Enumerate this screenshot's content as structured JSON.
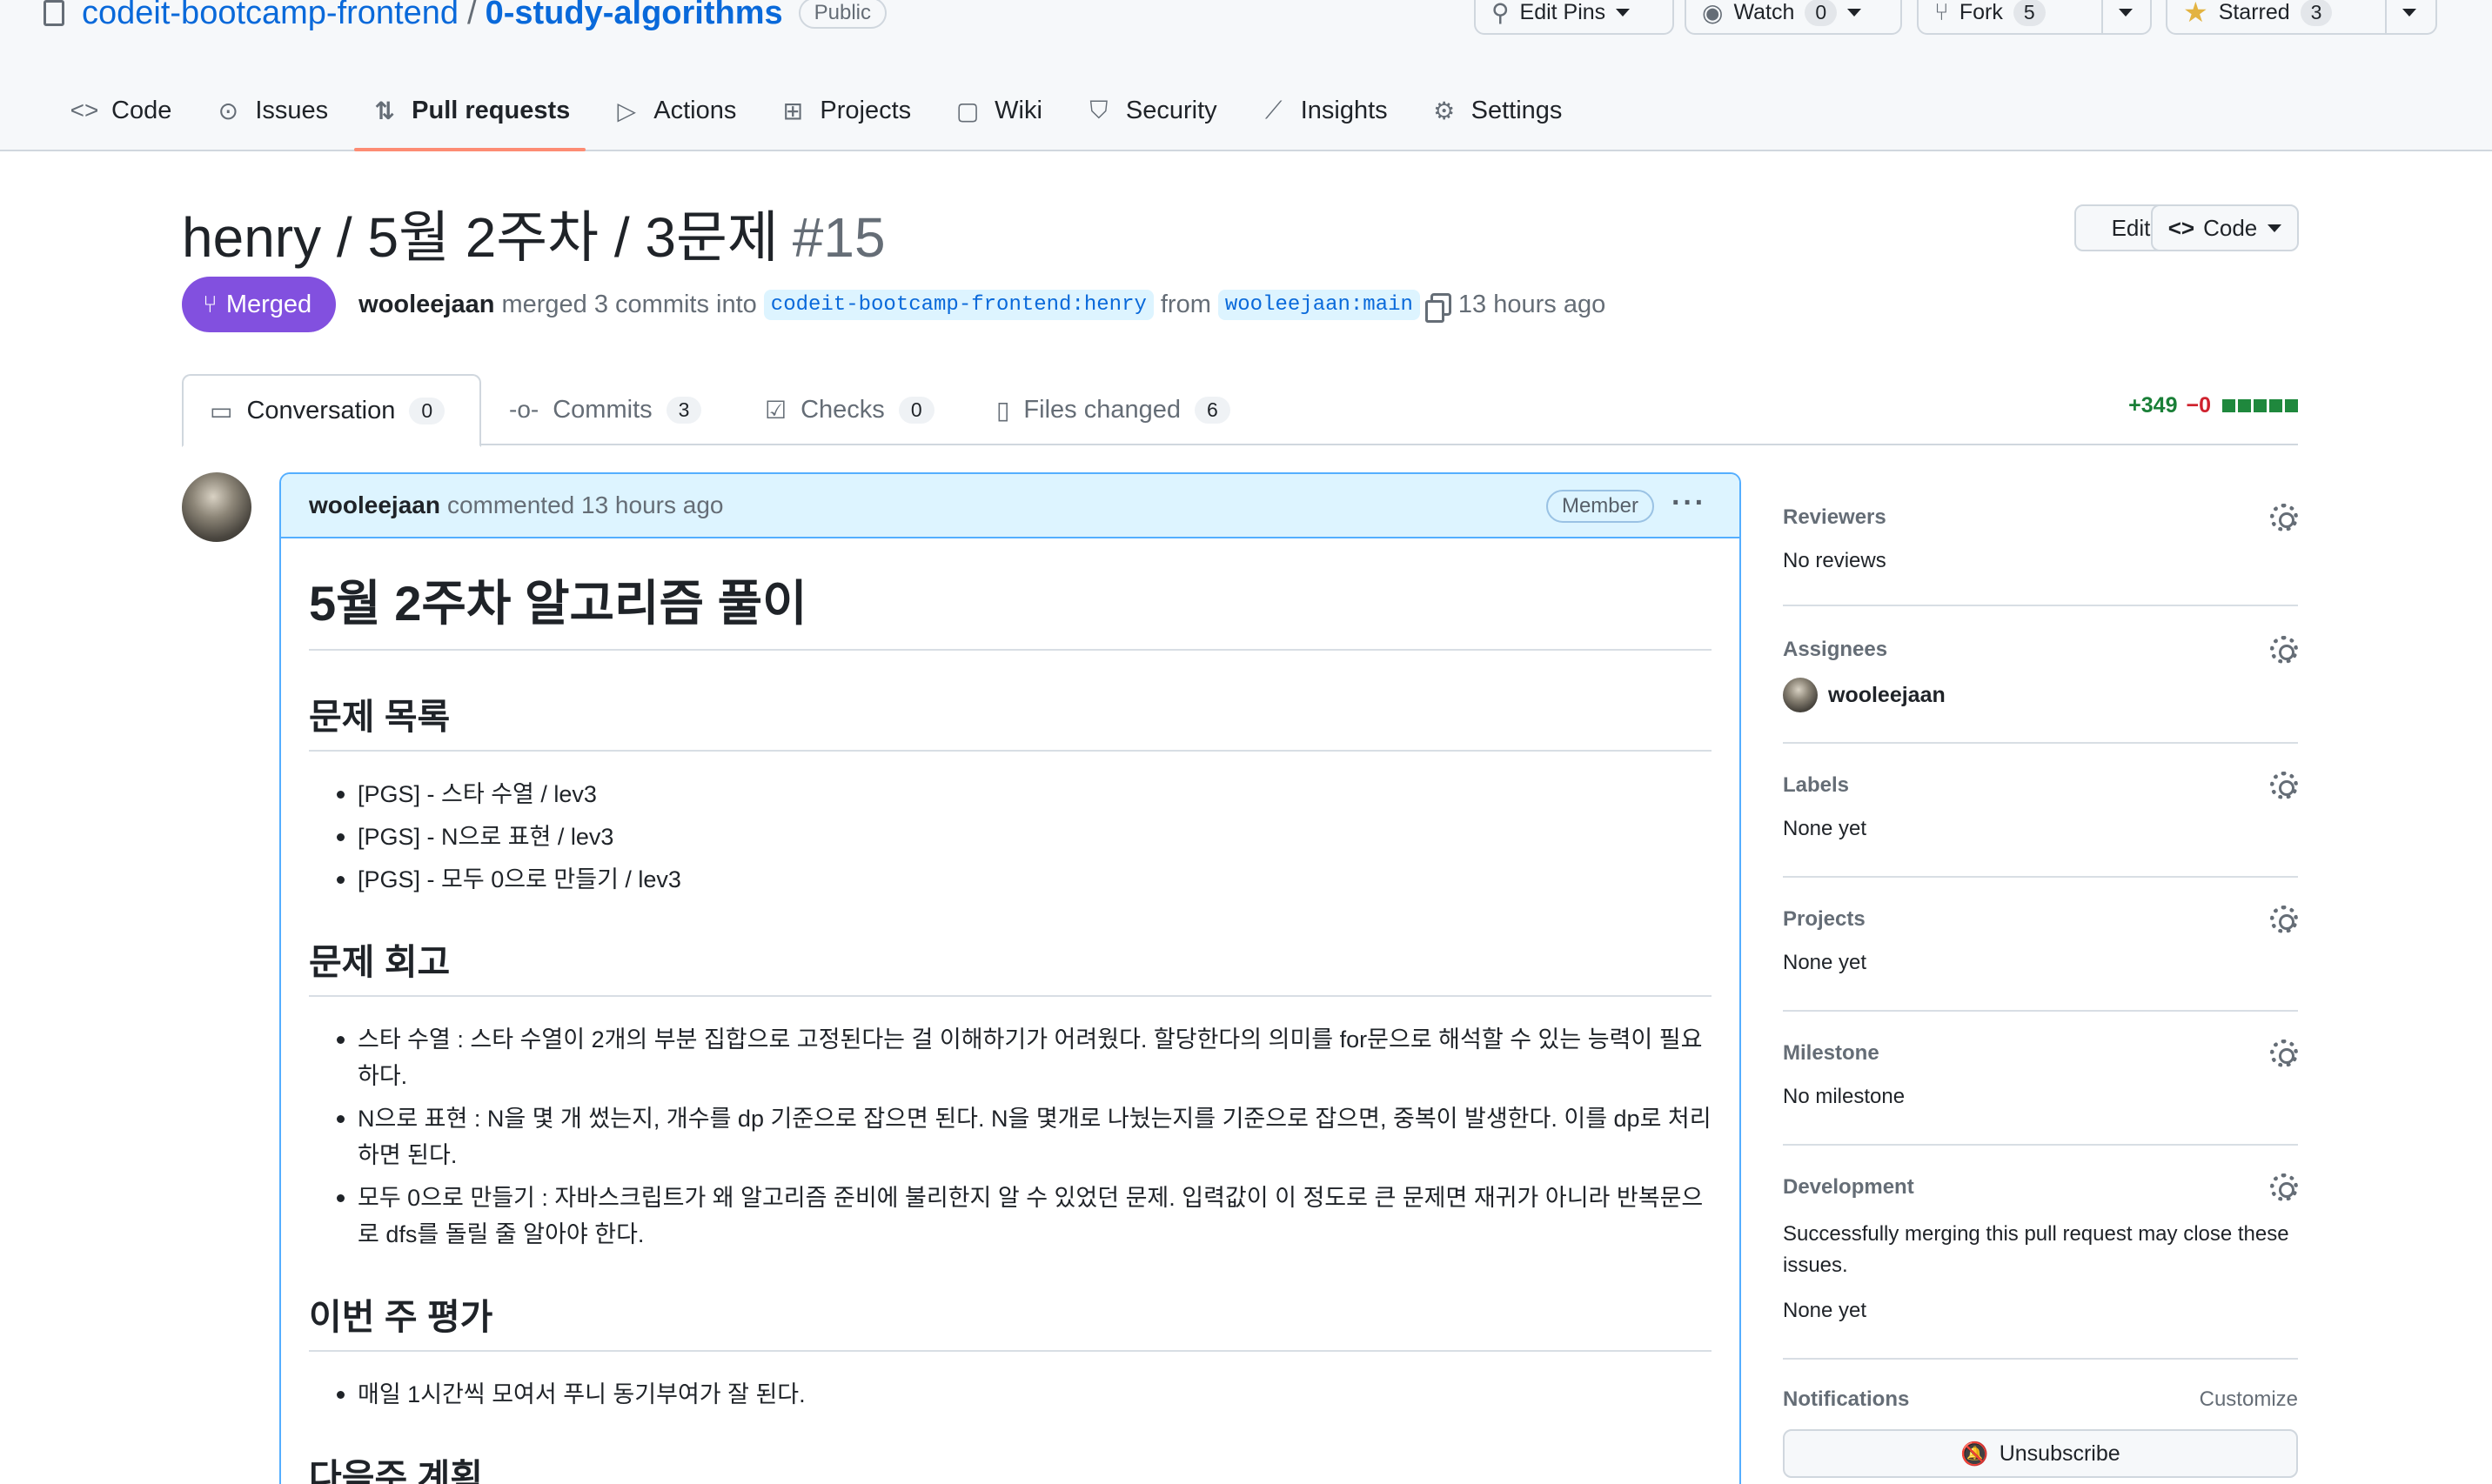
{
  "repo": {
    "owner": "codeit-bootcamp-frontend",
    "separator": "/",
    "name": "0-study-algorithms",
    "visibility": "Public"
  },
  "header_actions": {
    "edit_pins": "Edit Pins",
    "watch": "Watch",
    "watch_count": "0",
    "fork": "Fork",
    "fork_count": "5",
    "starred": "Starred",
    "star_count": "3"
  },
  "nav_tabs": [
    {
      "label": "Code",
      "icon": "code-icon"
    },
    {
      "label": "Issues",
      "icon": "issue-icon"
    },
    {
      "label": "Pull requests",
      "icon": "pull-request-icon",
      "active": true
    },
    {
      "label": "Actions",
      "icon": "play-icon"
    },
    {
      "label": "Projects",
      "icon": "table-icon"
    },
    {
      "label": "Wiki",
      "icon": "book-icon"
    },
    {
      "label": "Security",
      "icon": "shield-icon"
    },
    {
      "label": "Insights",
      "icon": "graph-icon"
    },
    {
      "label": "Settings",
      "icon": "gear-icon"
    }
  ],
  "pr": {
    "title": "henry / 5월 2주차 / 3문제",
    "number": "#15",
    "edit_label": "Edit",
    "code_label": "Code",
    "state": "Merged",
    "author": "wooleejaan",
    "merge_text": "merged 3 commits into",
    "base_branch": "codeit-bootcamp-frontend:henry",
    "from_text": "from",
    "head_branch": "wooleejaan:main",
    "time": "13 hours ago"
  },
  "pr_tabs": [
    {
      "label": "Conversation",
      "count": "0",
      "icon": "comment-icon"
    },
    {
      "label": "Commits",
      "count": "3",
      "icon": "commit-icon"
    },
    {
      "label": "Checks",
      "count": "0",
      "icon": "checklist-icon"
    },
    {
      "label": "Files changed",
      "count": "6",
      "icon": "file-diff-icon"
    }
  ],
  "diffstat": {
    "additions": "+349",
    "deletions": "−0",
    "blocks": 5
  },
  "comment": {
    "author": "wooleejaan",
    "action": "commented 13 hours ago",
    "role": "Member",
    "more": "···",
    "heading": "5월 2주차 알고리즘 풀이",
    "sections": [
      {
        "title": "문제 목록",
        "items": [
          "[PGS] - 스타 수열 / lev3",
          "[PGS] - N으로 표현 / lev3",
          "[PGS] - 모두 0으로 만들기 / lev3"
        ]
      },
      {
        "title": "문제 회고",
        "items": [
          "스타 수열 : 스타 수열이 2개의 부분 집합으로 고정된다는 걸 이해하기가 어려웠다. 할당한다의 의미를 for문으로 해석할 수 있는 능력이 필요하다.",
          "N으로 표현 : N을 몇 개 썼는지, 개수를 dp 기준으로 잡으면 된다. N을 몇개로 나눴는지를 기준으로 잡으면, 중복이 발생한다. 이를 dp로 처리하면 된다.",
          "모두 0으로 만들기 : 자바스크립트가 왜 알고리즘 준비에 불리한지 알 수 있었던 문제. 입력값이 이 정도로 큰 문제면 재귀가 아니라 반복문으로 dfs를 돌릴 줄 알아야 한다."
        ]
      },
      {
        "title": "이번 주 평가",
        "items": [
          "매일 1시간씩 모여서 푸니 동기부여가 잘 된다."
        ]
      },
      {
        "title": "다음주 계획",
        "items": []
      }
    ]
  },
  "sidebar": {
    "reviewers": {
      "title": "Reviewers",
      "value": "No reviews"
    },
    "assignees": {
      "title": "Assignees",
      "user": "wooleejaan"
    },
    "labels": {
      "title": "Labels",
      "value": "None yet"
    },
    "projects": {
      "title": "Projects",
      "value": "None yet"
    },
    "milestone": {
      "title": "Milestone",
      "value": "No milestone"
    },
    "development": {
      "title": "Development",
      "description": "Successfully merging this pull request may close these issues.",
      "value": "None yet"
    },
    "notifications": {
      "title": "Notifications",
      "customize": "Customize",
      "unsubscribe": "Unsubscribe"
    }
  }
}
